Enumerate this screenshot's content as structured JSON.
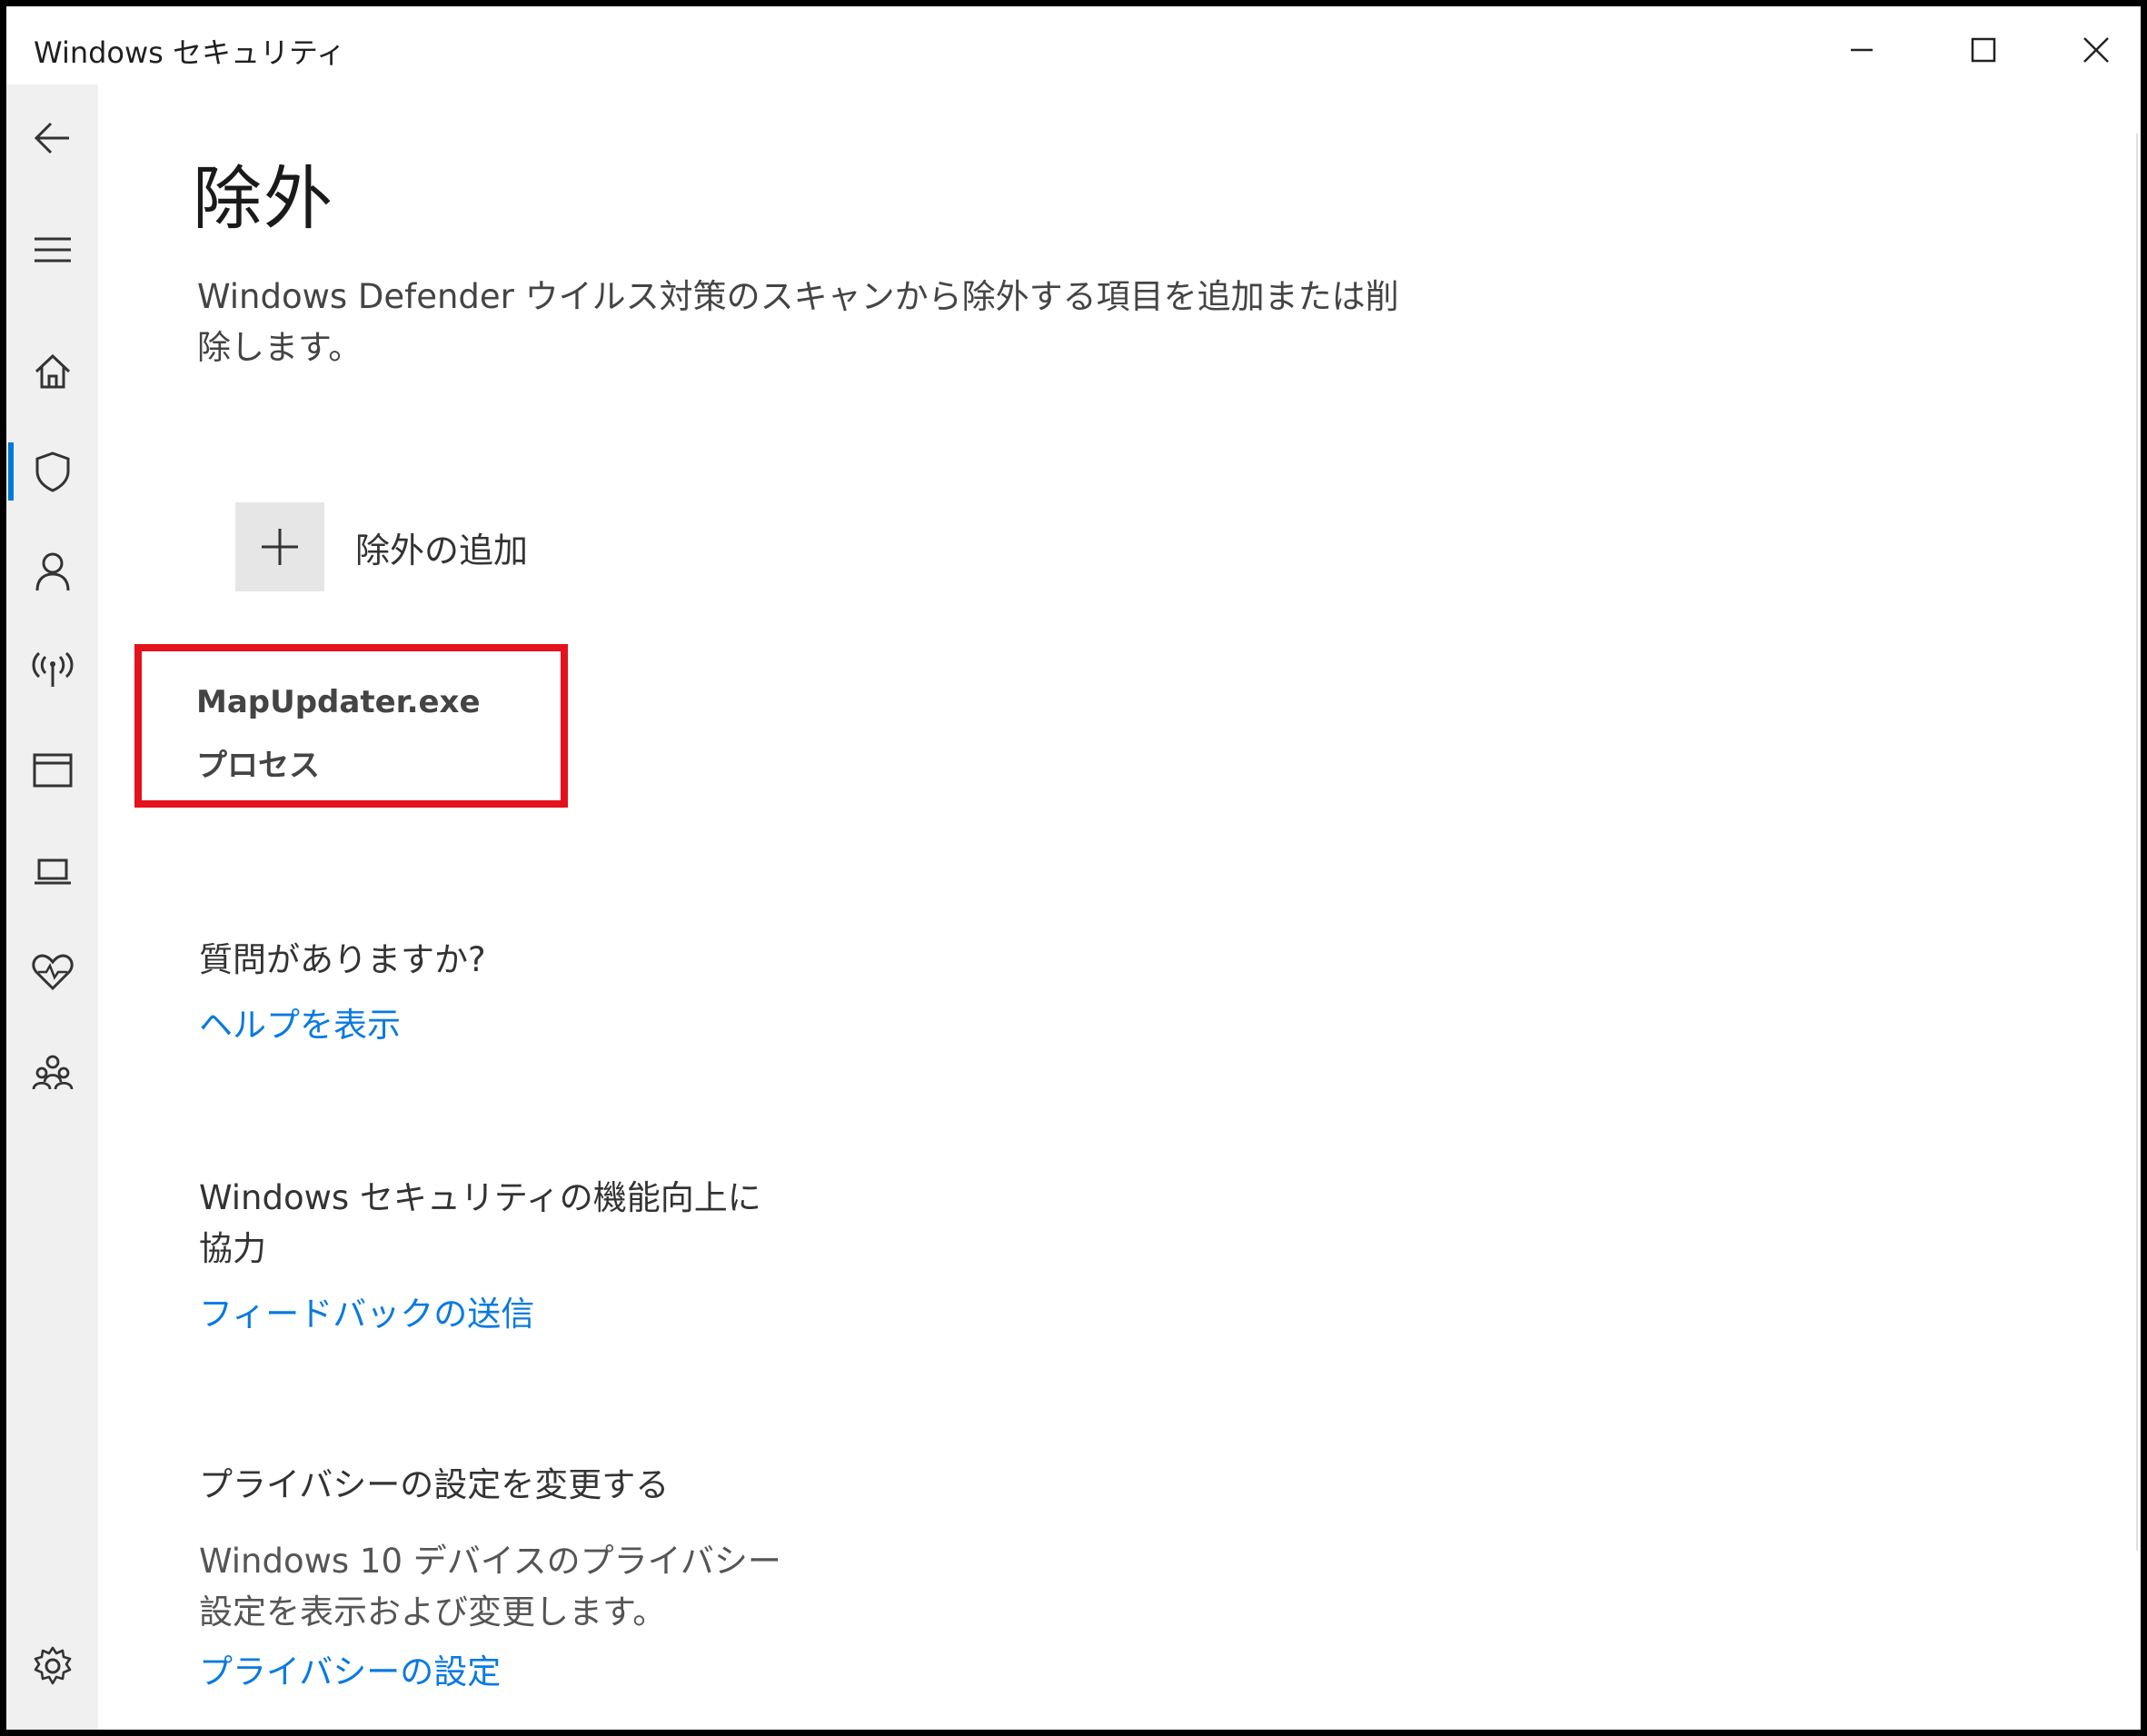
{
  "window": {
    "title": "Windows セキュリティ"
  },
  "nav": {
    "items": [
      {
        "name": "back-icon"
      },
      {
        "name": "hamburger-menu-icon"
      },
      {
        "name": "home-icon"
      },
      {
        "name": "shield-icon",
        "active": true
      },
      {
        "name": "person-icon"
      },
      {
        "name": "wireless-antenna-icon"
      },
      {
        "name": "app-browser-icon"
      },
      {
        "name": "laptop-icon"
      },
      {
        "name": "heart-health-icon"
      },
      {
        "name": "family-icon"
      },
      {
        "name": "settings-gear-icon"
      }
    ],
    "accent_color": "#0078d7"
  },
  "main": {
    "title": "除外",
    "description": "Windows Defender ウイルス対策のスキャンから除外する項目を追加または削除します。",
    "add_button_label": "除外の追加",
    "exclusions": [
      {
        "name": "MapUpdater.exe",
        "type": "プロセス"
      }
    ],
    "highlight_color": "#e3121c"
  },
  "help": {
    "heading": "質問がありますか?",
    "link": "ヘルプを表示"
  },
  "feedback": {
    "heading": "Windows セキュリティの機能向上に協力",
    "link": "フィードバックの送信"
  },
  "privacy": {
    "heading": "プライバシーの設定を変更する",
    "text": "Windows 10 デバイスのプライバシー設定を表示および変更します。",
    "link": "プライバシーの設定",
    "link_color": "#0a7ae0"
  }
}
